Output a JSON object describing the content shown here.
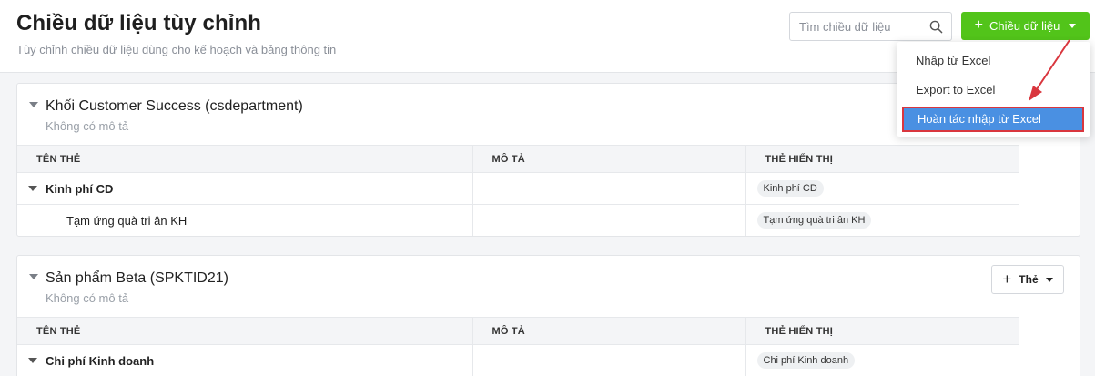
{
  "header": {
    "title": "Chiều dữ liệu tùy chỉnh",
    "subtitle": "Tùy chỉnh chiều dữ liệu dùng cho kế hoạch và bảng thông tin",
    "search_placeholder": "Tìm chiều dữ liệu",
    "primary_button_label": "Chiều dữ liệu",
    "primary_button_color": "#52c41a"
  },
  "dropdown": {
    "items": [
      {
        "label": "Nhập từ Excel"
      },
      {
        "label": "Export to Excel"
      },
      {
        "label": "Hoàn tác nhập từ Excel",
        "highlighted": true
      }
    ],
    "highlight_color": "#4a90e2",
    "annotation_color": "#d9363e"
  },
  "groups": [
    {
      "title": "Khối Customer Success (csdepartment)",
      "description": "Không có mô tả",
      "columns": [
        "TÊN THẺ",
        "MÔ TẢ",
        "THẺ HIỂN THỊ"
      ],
      "rows": [
        {
          "name": "Kinh phí CD",
          "description": "",
          "display_tag": "Kinh phí CD",
          "level": "parent"
        },
        {
          "name": "Tạm ứng quà tri ân KH",
          "description": "",
          "display_tag": "Tạm ứng quà tri ân KH",
          "level": "child"
        }
      ]
    },
    {
      "title": "Sản phẩm Beta (SPKTID21)",
      "description": "Không có mô tả",
      "add_button_label": "Thẻ",
      "columns": [
        "TÊN THẺ",
        "MÔ TẢ",
        "THẺ HIỂN THỊ"
      ],
      "rows": [
        {
          "name": "Chi phí Kinh doanh",
          "description": "",
          "display_tag": "Chi phí Kinh doanh",
          "level": "parent"
        }
      ]
    }
  ]
}
